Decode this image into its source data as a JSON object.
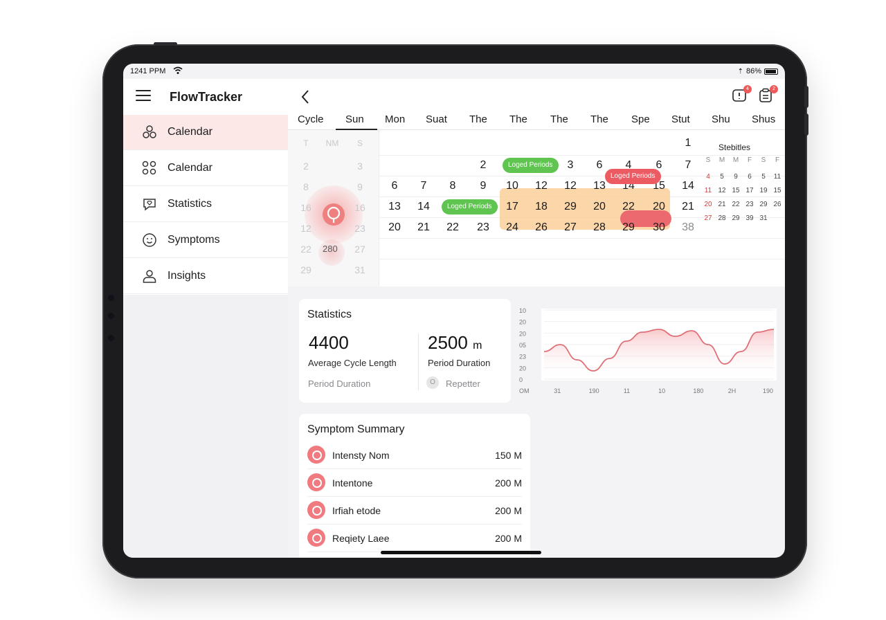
{
  "status": {
    "time": "1241 PPM",
    "battery": "86%"
  },
  "app": {
    "title": "FlowTracker"
  },
  "sidebar": {
    "items": [
      {
        "label": "Calendar",
        "icon": "calendar-bubbles-icon",
        "active": true
      },
      {
        "label": "Calendar",
        "icon": "grid-circles-icon",
        "active": false
      },
      {
        "label": "Statistics",
        "icon": "heart-chat-icon",
        "active": false
      },
      {
        "label": "Symptoms",
        "icon": "smiley-icon",
        "active": false
      },
      {
        "label": "Insights",
        "icon": "person-icon",
        "active": false
      }
    ]
  },
  "header": {
    "badge1": "4",
    "badge2": "2"
  },
  "tabs": [
    "Cycle",
    "Sun",
    "Mon",
    "Suat",
    "The",
    "The",
    "The",
    "The",
    "Spe",
    "Stut",
    "Shu",
    "Shus"
  ],
  "mini_column": {
    "header": [
      "T",
      "NM",
      "S"
    ],
    "numbers": [
      "2",
      "3",
      "8",
      "9",
      "16",
      "16",
      "12",
      "23",
      "22",
      "27",
      "29",
      "31"
    ],
    "badge": "280"
  },
  "calendar": {
    "row0": [
      "1"
    ],
    "row1": [
      "2",
      "3",
      "6",
      "4",
      "6",
      "7"
    ],
    "row2": [
      "6",
      "7",
      "8",
      "9",
      "10",
      "12",
      "12",
      "13",
      "14",
      "15",
      "14"
    ],
    "row3": [
      "13",
      "14",
      "17",
      "18",
      "29",
      "20",
      "22",
      "20",
      "21"
    ],
    "row4": [
      "20",
      "21",
      "22",
      "23",
      "24",
      "26",
      "27",
      "28",
      "29",
      "30",
      "38"
    ],
    "pills": [
      "Loged Periods",
      "Loged Periods",
      "Loged Periods"
    ]
  },
  "mini_calendar": {
    "title": "Stebitles",
    "headers": [
      "S",
      "M",
      "M",
      "F",
      "S",
      "F"
    ],
    "rows": [
      [
        "4",
        "5",
        "9",
        "6",
        "5",
        "11"
      ],
      [
        "11",
        "12",
        "15",
        "17",
        "19",
        "15"
      ],
      [
        "20",
        "21",
        "22",
        "23",
        "29",
        "26"
      ],
      [
        "27",
        "28",
        "29",
        "39",
        "31",
        ""
      ]
    ]
  },
  "stats": {
    "title": "Statistics",
    "left_value": "4400",
    "left_label": "Average Cycle Length",
    "left_sub": "Period Duration",
    "right_value": "2500",
    "right_unit": "m",
    "right_label": "Period Duration",
    "right_sub": "Repetter"
  },
  "chart_data": {
    "type": "area",
    "y_ticks": [
      "10",
      "20",
      "20",
      "05",
      "23",
      "20",
      "0"
    ],
    "x_ticks": [
      "OM",
      "31",
      "190",
      "11",
      "10",
      "180",
      "2H",
      "190"
    ],
    "series": [
      {
        "values": [
          40,
          50,
          28,
          12,
          30,
          55,
          68,
          72,
          62,
          70,
          50,
          22,
          40,
          68,
          72
        ]
      }
    ],
    "color": "#e07078"
  },
  "symptoms": {
    "title": "Symptom Summary",
    "items": [
      {
        "label": "Intensty Nom",
        "value": "150 M"
      },
      {
        "label": "Intentone",
        "value": "200 M"
      },
      {
        "label": "Irfiah etode",
        "value": "200 M"
      },
      {
        "label": "Reqiety Laee",
        "value": "200 M"
      }
    ]
  }
}
